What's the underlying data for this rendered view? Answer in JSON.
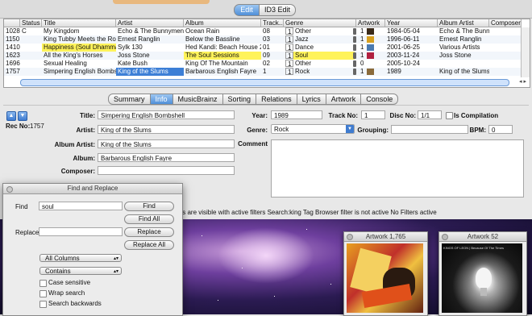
{
  "segmented": {
    "edit": "Edit",
    "id3_edit": "ID3 Edit"
  },
  "table": {
    "columns": [
      "Status",
      "Title",
      "Artist",
      "Album",
      "Track...",
      "Genre",
      "Artwork",
      "Year",
      "Album Artist",
      "Composer"
    ],
    "rows": [
      {
        "rec": "1028",
        "status": "C",
        "title": "My Kingdom",
        "artist": "Echo & The Bunnymen",
        "album": "Ocean Rain",
        "track": "08",
        "disc": "1",
        "genre": "Other",
        "art": "1",
        "year": "1984-05-04",
        "album_artist": "Echo & The Bunny"
      },
      {
        "rec": "1150",
        "status": "",
        "title": "King Tubby Meets the Rock",
        "artist": "Ernest Ranglin",
        "album": "Below the Bassline",
        "track": "03",
        "disc": "1",
        "genre": "Jazz",
        "art": "1",
        "year": "1996-06-11",
        "album_artist": "Ernest Ranglin"
      },
      {
        "rec": "1410",
        "status": "",
        "title": "Happiness (Soul Dhamma )",
        "artist": "Sylk 130",
        "album": "Hed Kandi: Beach House 2 (I",
        "track": "01",
        "disc": "1",
        "genre": "Dance",
        "art": "1",
        "year": "2001-06-25",
        "album_artist": "Various Artists"
      },
      {
        "rec": "1623",
        "status": "",
        "title": "All the King's Horses",
        "artist": "Joss Stone",
        "album": "The Soul Sessions",
        "track": "09",
        "disc": "1",
        "genre": "Soul",
        "art": "1",
        "year": "2003-11-24",
        "album_artist": "Joss Stone"
      },
      {
        "rec": "1696",
        "status": "",
        "title": "Sexual Healing",
        "artist": "Kate Bush",
        "album": "King Of The Mountain",
        "track": "02",
        "disc": "1",
        "genre": "Other",
        "art": "0",
        "year": "2005-10-24",
        "album_artist": ""
      },
      {
        "rec": "1757",
        "status": "",
        "title": "Simpering English Bombsh",
        "artist": "King of the Slums",
        "album": "Barbarous English Fayre",
        "track": "1",
        "disc": "1",
        "genre": "Rock",
        "art": "1",
        "year": "1989",
        "album_artist": "King of the Slums"
      }
    ]
  },
  "tabs": [
    "Summary",
    "Info",
    "MusicBrainz",
    "Sorting",
    "Relations",
    "Lyrics",
    "Artwork",
    "Console"
  ],
  "selected_tab": "Info",
  "info": {
    "rec_label": "Rec No:",
    "rec_value": "1757",
    "title_label": "Title:",
    "title_value": "Simpering English Bombshell",
    "artist_label": "Artist:",
    "artist_value": "King of the Slums",
    "album_artist_label": "Album Artist:",
    "album_artist_value": "King of the Slums",
    "album_label": "Album:",
    "album_value": "Barbarous English Fayre",
    "composer_label": "Composer:",
    "composer_value": "",
    "year_label": "Year:",
    "year_value": "1989",
    "track_label": "Track No:",
    "track_value": "1",
    "disc_label": "Disc No:",
    "disc_value": "1/1",
    "compilation_label": "Is Compilation",
    "genre_label": "Genre:",
    "genre_value": "Rock",
    "grouping_label": "Grouping:",
    "grouping_value": "",
    "bpm_label": "BPM:",
    "bpm_value": "0",
    "comment_label": "Comment"
  },
  "status_bar": "les are visible with active filters   Search:king Tag Browser filter is not active   No Filters active",
  "artwork_windows": [
    {
      "title": "Artwork 1,765"
    },
    {
      "title": "Artwork 52",
      "album_text": "KINGS OF LEON  |  Because Of The Times"
    }
  ],
  "find_dialog": {
    "title": "Find and Replace",
    "find_label": "Find",
    "find_value": "soul",
    "replace_label": "Replace",
    "replace_value": "",
    "buttons": {
      "find": "Find",
      "find_all": "Find All",
      "replace": "Replace",
      "replace_all": "Replace All"
    },
    "columns_select": "All Columns",
    "match_select": "Contains",
    "case_sensitive": "Case sensitive",
    "wrap_search": "Wrap search",
    "search_backwards": "Search backwards"
  },
  "colors": {
    "highlight": "#fff35a",
    "selection": "#3d7fd6",
    "accent": "#4f8fd8"
  }
}
